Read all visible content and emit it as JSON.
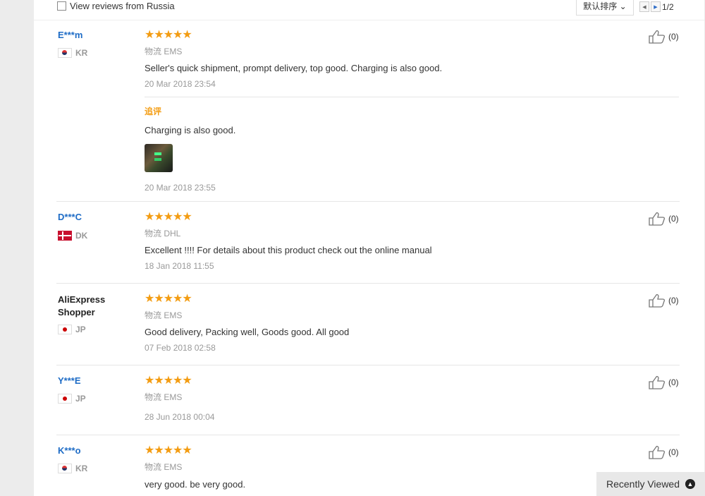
{
  "filter": {
    "label": "View reviews from Russia"
  },
  "sort": {
    "label": "默认排序 ⌄"
  },
  "pager": {
    "prev": "◀",
    "next": "▶",
    "page": "1/2"
  },
  "reviews": [
    {
      "user": "E***m",
      "country": "KR",
      "flag": "kr",
      "stars": "★★★★★",
      "logistics": "物流 EMS",
      "text": "Seller's quick shipment, prompt delivery, top good. Charging is also good.",
      "date": "20 Mar 2018 23:54",
      "helpful": "(0)",
      "additional": {
        "label": "追评",
        "text": "Charging is also good.",
        "date": "20 Mar 2018 23:55"
      }
    },
    {
      "user": "D***C",
      "country": "DK",
      "flag": "dk",
      "stars": "★★★★★",
      "logistics": "物流 DHL",
      "text": "Excellent !!!! For details about this product check out the online manual",
      "date": "18 Jan 2018 11:55",
      "helpful": "(0)"
    },
    {
      "user": "AliExpress Shopper",
      "country": "JP",
      "flag": "jp",
      "stars": "★★★★★",
      "logistics": "物流 EMS",
      "text": "Good delivery, Packing well, Goods good. All good",
      "date": "07 Feb 2018 02:58",
      "helpful": "(0)"
    },
    {
      "user": "Y***E",
      "country": "JP",
      "flag": "jp",
      "stars": "★★★★★",
      "logistics": "物流 EMS",
      "text": "",
      "date": "28 Jun 2018 00:04",
      "helpful": "(0)"
    },
    {
      "user": "K***o",
      "country": "KR",
      "flag": "kr",
      "stars": "★★★★★",
      "logistics": "物流 EMS",
      "text": "very good. be very good.",
      "date": "",
      "helpful": "(0)"
    }
  ],
  "recently_viewed": {
    "label": "Recently Viewed",
    "icon": "chevron-up-circle-icon"
  },
  "colors": {
    "username": "#1e6cc6",
    "stars": "#f39c12",
    "muted": "#999999"
  }
}
